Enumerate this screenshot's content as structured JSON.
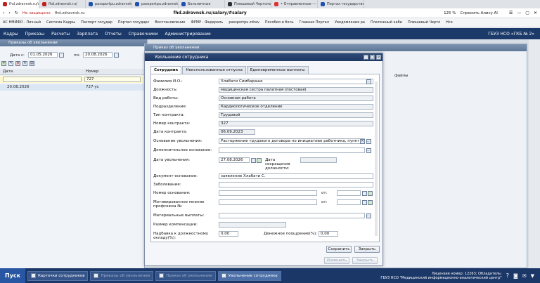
{
  "browser": {
    "tabs": [
      {
        "label": "fhd.zdravnsk.ru/salary/",
        "color": "#c02020",
        "active": true
      },
      {
        "label": "fhd.zdravnsk.ru/",
        "color": "#c02020"
      },
      {
        "label": "passportpu.zdravnsk.ru/",
        "color": "#2050b0"
      },
      {
        "label": "passportpu.zdravnsk.ru",
        "color": "#2050b0"
      },
      {
        "label": "Больничные",
        "color": "#2050b0"
      },
      {
        "label": "Плюшевый Чертополох",
        "color": "#303030"
      },
      {
        "label": "• Отправленные — Яндекс",
        "color": "#e03030"
      },
      {
        "label": "Портал государственных",
        "color": "#2050b0"
      }
    ],
    "insecure_label": "Не защищено",
    "url_host": "fhd.zdravnsk.ru",
    "url_title": "fhd.zdravnsk.ru/salary/#salary",
    "zoom": "125 %",
    "ask_alice": "Спросить Алису AI",
    "bookmarks": [
      "АС НМИФО - Личный",
      "Система Кадры",
      "Паспорт государ",
      "Портал государс",
      "Восстановление",
      "ФРМР - Федераль",
      "passportpu.zdrav",
      "Пособия и боль",
      "Главная Портал",
      "Уведомления ра",
      "Платежный каби",
      "Плюшевый Черто",
      "Нсо"
    ]
  },
  "app_menu": {
    "items": [
      "Кадры",
      "Приказы",
      "Расчеты",
      "Зарплата",
      "Отчеты",
      "Справочники",
      "Администрирование"
    ],
    "org": "ГБУЗ НСО «ГКБ № 2»"
  },
  "list_window": {
    "title": "Приказы об увольнении",
    "date_from_label": "Дата с:",
    "date_from": "01.05.2026",
    "date_to_label": "по:",
    "date_to": "20.08.2026",
    "col_date": "Дата",
    "col_number": "Номер",
    "filter_number": "727",
    "rows": [
      {
        "date": "20.08.2026",
        "number": "727-ус"
      }
    ]
  },
  "order_window": {
    "title": "Приказ об увольнении",
    "files_label": "файлы"
  },
  "dialog": {
    "title": "Увольнение сотрудника",
    "tabs": [
      "Сотрудник",
      "Неиспользованные отпуска",
      "Единовременные выплаты"
    ],
    "fields": {
      "fio_label": "Фамилия И.О.:",
      "fio": "Хлабати Симбарашe",
      "position_label": "Должность:",
      "position": "медицинская сестра палатная (постовая)",
      "worktype_label": "Вид работы:",
      "worktype": "Основная работа",
      "dept_label": "Подразделение:",
      "dept": "Кардиологическое отделение",
      "contract_type_label": "Тип контракта:",
      "contract_type": "Трудовой",
      "contract_no_label": "Номер контракта:",
      "contract_no": "327",
      "contract_date_label": "Дата контракта:",
      "contract_date": "06.09.2023",
      "reason_label": "Основание увольнения:",
      "reason": "Расторжение трудового договора по инициативе работника, пункт 3 части п",
      "extra_reason_label": "Дополнительное основание:",
      "extra_reason": "",
      "dismiss_date_label": "Дата увольнения:",
      "dismiss_date": "27.08.2026",
      "cut_date_label": "Дата сокращения должности:",
      "cut_date": "",
      "doc_basis_label": "Документ-основание:",
      "doc_basis": "заявление Хлабати С.",
      "disease_label": "Заболевание:",
      "disease": "",
      "basis_no_label": "Номер основания:",
      "basis_no": "",
      "from_label": "от:",
      "union_label": "Мотивированное мнение профсоюза №:",
      "union": "",
      "union_from_label": "от:",
      "material_label": "Материальные выплаты:",
      "material": "",
      "comp_label": "Размер компенсации:",
      "comp": "",
      "allowance_label": "Надбавка к должностному окладу(%):",
      "allowance": "0,00",
      "bonus_label": "Денежное поощрение(%):",
      "bonus": "0,00"
    },
    "btn_save": "Сохранить",
    "btn_close": "Закрыть",
    "btn_change": "Изменить",
    "btn_close2": "Закрыть"
  },
  "taskbar": {
    "start": "Пуск",
    "items": [
      "Карточки сотрудников",
      "Приказы об увольнении",
      "Приказ об увольнении",
      "Увольнение сотрудника"
    ],
    "license": "Лицензия номер: 12263; Обладатель:",
    "owner": "ГБУЗ НСО \"Медицинский информационно-аналитический центр\""
  }
}
